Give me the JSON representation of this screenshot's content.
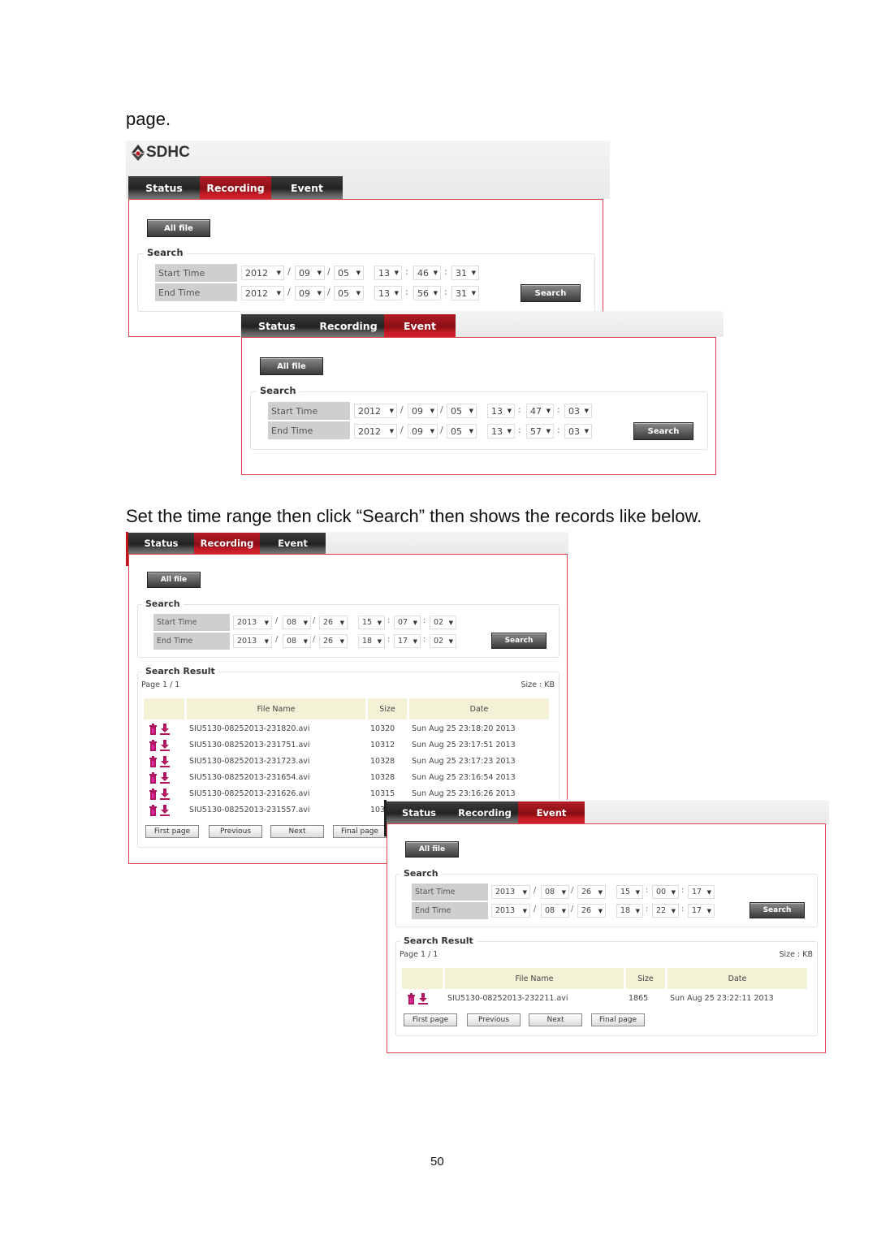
{
  "document": {
    "intro_text": "page.",
    "instruction_text": "Set the time range then click “Search” then shows the records like below.",
    "page_number": "50"
  },
  "colors": {
    "accent_red": "#b51d25",
    "tab_dark": "#2a2a2a",
    "icon_magenta": "#b0155f",
    "table_header": "#f4f2d6"
  },
  "app": {
    "logo_text": "SDHC"
  },
  "tabs": [
    "Status",
    "Recording",
    "Event"
  ],
  "common": {
    "all_file_label": "All file",
    "search_legend": "Search",
    "start_time_label": "Start Time",
    "end_time_label": "End Time",
    "search_button": "Search",
    "search_result_legend": "Search Result",
    "size_unit": "Size : KB",
    "columns": [
      "File Name",
      "Size",
      "Date"
    ],
    "pager": [
      "First page",
      "Previous",
      "Next",
      "Final page"
    ]
  },
  "screenshots": [
    {
      "active_tab": "Recording",
      "start": {
        "year": "2012",
        "month": "09",
        "day": "05",
        "hour": "13",
        "minute": "46",
        "second": "31"
      },
      "end": {
        "year": "2012",
        "month": "09",
        "day": "05",
        "hour": "13",
        "minute": "56",
        "second": "31"
      }
    },
    {
      "active_tab": "Event",
      "start": {
        "year": "2012",
        "month": "09",
        "day": "05",
        "hour": "13",
        "minute": "47",
        "second": "03"
      },
      "end": {
        "year": "2012",
        "month": "09",
        "day": "05",
        "hour": "13",
        "minute": "57",
        "second": "03"
      }
    },
    {
      "active_tab": "Recording",
      "start": {
        "year": "2013",
        "month": "08",
        "day": "26",
        "hour": "15",
        "minute": "07",
        "second": "02"
      },
      "end": {
        "year": "2013",
        "month": "08",
        "day": "26",
        "hour": "18",
        "minute": "17",
        "second": "02"
      },
      "page_info": "Page 1 / 1",
      "rows": [
        {
          "file": "SIU5130-08252013-231820.avi",
          "size": "10320",
          "date": "Sun Aug 25 23:18:20 2013"
        },
        {
          "file": "SIU5130-08252013-231751.avi",
          "size": "10312",
          "date": "Sun Aug 25 23:17:51 2013"
        },
        {
          "file": "SIU5130-08252013-231723.avi",
          "size": "10328",
          "date": "Sun Aug 25 23:17:23 2013"
        },
        {
          "file": "SIU5130-08252013-231654.avi",
          "size": "10328",
          "date": "Sun Aug 25 23:16:54 2013"
        },
        {
          "file": "SIU5130-08252013-231626.avi",
          "size": "10315",
          "date": "Sun Aug 25 23:16:26 2013"
        },
        {
          "file": "SIU5130-08252013-231557.avi",
          "size": "103",
          "date": ""
        }
      ]
    },
    {
      "active_tab": "Event",
      "start": {
        "year": "2013",
        "month": "08",
        "day": "26",
        "hour": "15",
        "minute": "00",
        "second": "17"
      },
      "end": {
        "year": "2013",
        "month": "08",
        "day": "26",
        "hour": "18",
        "minute": "22",
        "second": "17"
      },
      "page_info": "Page 1 / 1",
      "rows": [
        {
          "file": "SIU5130-08252013-232211.avi",
          "size": "1865",
          "date": "Sun Aug 25 23:22:11 2013"
        }
      ]
    }
  ]
}
